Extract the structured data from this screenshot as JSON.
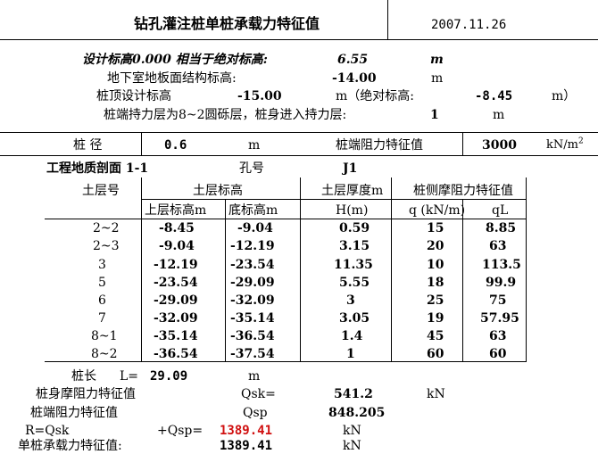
{
  "title": "钻孔灌注桩单桩承载力特征值",
  "date": "2007.11.26",
  "design_elevation": {
    "label": "设计标高0.000 相当于绝对标高:",
    "value": "6.55",
    "unit": "m"
  },
  "basement": {
    "label": "地下室地板面结构标高:",
    "value": "-14.00",
    "unit": "m"
  },
  "pile_top": {
    "label": "桩顶设计标高",
    "value": "-15.00",
    "abs_label": "m（绝对标高:",
    "abs_value": "-8.45",
    "close": "m）"
  },
  "bearing": {
    "label": "桩端持力层为8~2圆砾层，桩身进入持力层:",
    "value": "1",
    "unit": "m"
  },
  "diameter": {
    "label": "桩  径",
    "value": "0.6",
    "unit": "m"
  },
  "tip_resistance": {
    "label": "桩端阻力特征值",
    "value": "3000",
    "unit": "kN/m",
    "unit_sup": "2"
  },
  "profile": {
    "label": "工程地质剖面 1-1",
    "hole_label": "孔号",
    "hole": "J1"
  },
  "headers": {
    "layer": "土层号",
    "elevation": "土层标高",
    "thickness": "土层厚度m",
    "friction": "桩侧摩阻力特征值",
    "top": "上层标高m",
    "bottom": "底标高m",
    "h": "H(m)",
    "q": "q (kN/m)",
    "ql": "qL"
  },
  "rows": [
    {
      "layer": "2~2",
      "top": "-8.45",
      "bottom": "-9.04",
      "h": "0.59",
      "q": "15",
      "ql": "8.85"
    },
    {
      "layer": "2~3",
      "top": "-9.04",
      "bottom": "-12.19",
      "h": "3.15",
      "q": "20",
      "ql": "63"
    },
    {
      "layer": "3",
      "top": "-12.19",
      "bottom": "-23.54",
      "h": "11.35",
      "q": "10",
      "ql": "113.5"
    },
    {
      "layer": "5",
      "top": "-23.54",
      "bottom": "-29.09",
      "h": "5.55",
      "q": "18",
      "ql": "99.9"
    },
    {
      "layer": "6",
      "top": "-29.09",
      "bottom": "-32.09",
      "h": "3",
      "q": "25",
      "ql": "75"
    },
    {
      "layer": "7",
      "top": "-32.09",
      "bottom": "-35.14",
      "h": "3.05",
      "q": "19",
      "ql": "57.95"
    },
    {
      "layer": "8~1",
      "top": "-35.14",
      "bottom": "-36.54",
      "h": "1.4",
      "q": "45",
      "ql": "63"
    },
    {
      "layer": "8~2",
      "top": "-36.54",
      "bottom": "-37.54",
      "h": "1",
      "q": "60",
      "ql": "60"
    }
  ],
  "pile_length": {
    "label": "桩长",
    "eq": "L=",
    "value": "29.09",
    "unit": "m"
  },
  "shaft": {
    "label": "桩身摩阻力特征值",
    "symbol": "Qsk=",
    "value": "541.2",
    "unit": "kN"
  },
  "tip": {
    "label": "桩端阻力特征值",
    "symbol": "Qsp",
    "value": "848.205"
  },
  "total": {
    "label": "R=Qsk",
    "plus": "+Qsp=",
    "value": "1389.41",
    "unit": "kN"
  },
  "single": {
    "label": "单桩承载力特征值:",
    "value": "1389.41",
    "unit": "kN"
  }
}
